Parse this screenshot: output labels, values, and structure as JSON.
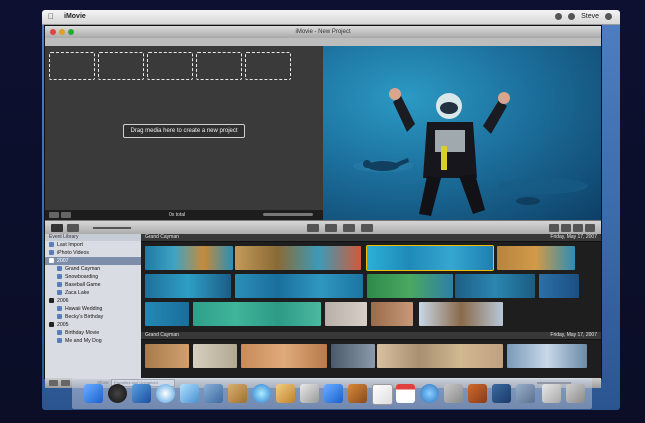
{
  "menubar": {
    "app_name": "iMovie",
    "user_name": "Steve"
  },
  "window": {
    "title": "iMovie - New Project"
  },
  "project": {
    "drop_message": "Drag media here to create a new project",
    "total_label": "0s total"
  },
  "event_library": {
    "title": "Event Library",
    "items": [
      {
        "label": "Last Import",
        "level": 1
      },
      {
        "label": "iPhoto Videos",
        "level": 1
      },
      {
        "label": "2007",
        "level": 1,
        "selected": true
      },
      {
        "label": "Grand Cayman",
        "level": 2
      },
      {
        "label": "Snowboarding",
        "level": 2
      },
      {
        "label": "Baseball Game",
        "level": 2
      },
      {
        "label": "Zaca Lake",
        "level": 2
      },
      {
        "label": "2006",
        "level": 1
      },
      {
        "label": "Hawaii Wedding",
        "level": 2
      },
      {
        "label": "Becky's Birthday",
        "level": 2
      },
      {
        "label": "2005",
        "level": 1
      },
      {
        "label": "Birthday Movie",
        "level": 2
      },
      {
        "label": "Me and My Dog",
        "level": 2
      }
    ]
  },
  "events": [
    {
      "name": "Grand Cayman",
      "date": "Friday, May 17, 2007"
    },
    {
      "name": "Grand Cayman",
      "date": "Friday, May 17, 2007"
    }
  ],
  "bottombar": {
    "show_label": "Show:",
    "show_value": "Favorites and Unmarked"
  },
  "colors": {
    "desktop": "#3a6aa8",
    "window_dark": "#2a2a2a",
    "selection_yellow": "#f0c000"
  },
  "icons": [
    "apple-icon",
    "finder-icon",
    "dashboard-icon",
    "safari-icon",
    "ichat-icon",
    "mail-icon",
    "itunes-icon",
    "iphoto-icon",
    "imovie-icon",
    "calendar-icon",
    "trash-icon"
  ]
}
